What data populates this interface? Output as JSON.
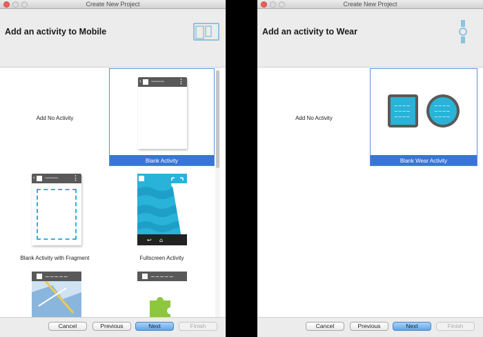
{
  "left_window": {
    "title": "Create New Project",
    "header": "Add an activity to Mobile",
    "tiles": [
      {
        "label": "Add No Activity"
      },
      {
        "label": "Blank Activity"
      },
      {
        "label": "Blank Activity with Fragment"
      },
      {
        "label": "Fullscreen Activity"
      }
    ],
    "buttons": {
      "cancel": "Cancel",
      "previous": "Previous",
      "next": "Next",
      "finish": "Finish"
    }
  },
  "right_window": {
    "title": "Create New Project",
    "header": "Add an activity to Wear",
    "tiles": [
      {
        "label": "Add No Activity"
      },
      {
        "label": "Blank Wear Activity"
      }
    ],
    "buttons": {
      "cancel": "Cancel",
      "previous": "Previous",
      "next": "Next",
      "finish": "Finish"
    }
  },
  "colors": {
    "selection": "#3875d7",
    "accent_teal": "#29b3d8",
    "phone_bar": "#595959"
  },
  "icons": [
    "mobile-device-icon",
    "wear-device-icon",
    "blank-activity-icon",
    "fragment-activity-icon",
    "fullscreen-activity-icon",
    "map-activity-icon",
    "puzzle-activity-icon",
    "wear-square-icon",
    "wear-round-icon"
  ]
}
